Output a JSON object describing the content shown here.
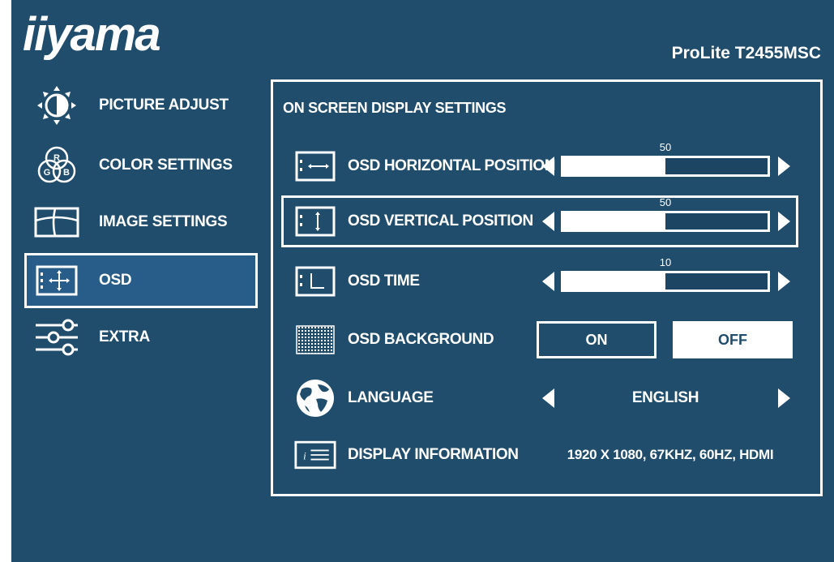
{
  "brand": "iiyama",
  "model": "ProLite T2455MSC",
  "sidebar": {
    "items": [
      {
        "label": "PICTURE ADJUST",
        "icon": "brightness-contrast-icon",
        "active": false
      },
      {
        "label": "COLOR SETTINGS",
        "icon": "rgb-icon",
        "active": false
      },
      {
        "label": "IMAGE SETTINGS",
        "icon": "image-settings-icon",
        "active": false
      },
      {
        "label": "OSD",
        "icon": "osd-move-icon",
        "active": true
      },
      {
        "label": "EXTRA",
        "icon": "sliders-icon",
        "active": false
      }
    ]
  },
  "panel": {
    "title": "ON SCREEN DISPLAY SETTINGS",
    "rows": [
      {
        "label": "OSD HORIZONTAL POSITION",
        "type": "slider",
        "value": 50,
        "max": 100,
        "icon": "horizontal-position-icon",
        "selected": false
      },
      {
        "label": "OSD VERTICAL POSITION",
        "type": "slider",
        "value": 50,
        "max": 100,
        "icon": "vertical-position-icon",
        "selected": true
      },
      {
        "label": "OSD TIME",
        "type": "slider",
        "value": 10,
        "max": 20,
        "icon": "osd-time-icon",
        "selected": false
      },
      {
        "label": "OSD BACKGROUND",
        "type": "toggle",
        "on_label": "ON",
        "off_label": "OFF",
        "icon": "osd-background-icon",
        "selected": false
      },
      {
        "label": "LANGUAGE",
        "type": "select",
        "value": "ENGLISH",
        "icon": "globe-icon",
        "selected": false
      },
      {
        "label": "DISPLAY INFORMATION",
        "type": "info",
        "value": "1920 X 1080, 67KHZ, 60HZ, HDMI",
        "icon": "info-icon",
        "selected": false
      }
    ]
  },
  "colors": {
    "background": "#204d6c",
    "selected_fill": "#275d88",
    "foreground": "#ffffff"
  }
}
